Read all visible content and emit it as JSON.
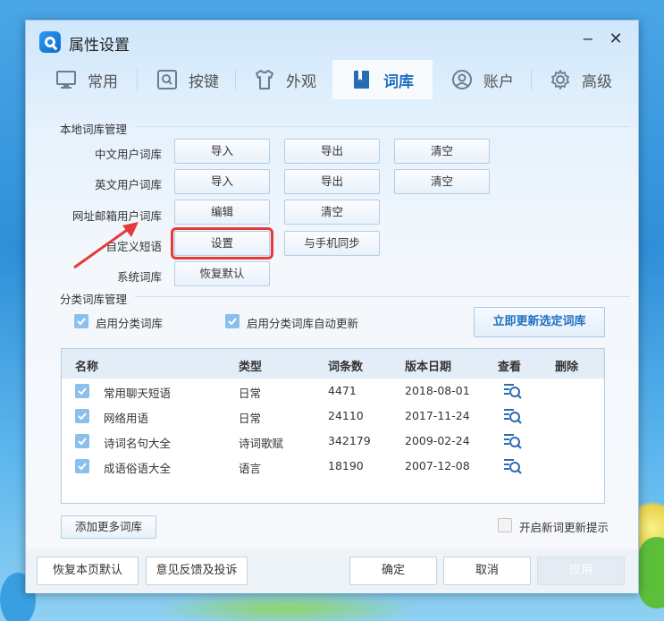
{
  "window": {
    "title": "属性设置",
    "minimize_glyph": "−",
    "close_glyph": "✕"
  },
  "tabs": [
    {
      "label": "常用",
      "icon": "monitor-icon"
    },
    {
      "label": "按键",
      "icon": "key-icon"
    },
    {
      "label": "外观",
      "icon": "shirt-icon"
    },
    {
      "label": "词库",
      "icon": "book-icon",
      "active": true
    },
    {
      "label": "账户",
      "icon": "user-icon"
    },
    {
      "label": "高级",
      "icon": "gear-icon"
    }
  ],
  "local": {
    "section_title": "本地词库管理",
    "rows": [
      {
        "label": "中文用户词库",
        "buttons": [
          "导入",
          "导出",
          "清空"
        ]
      },
      {
        "label": "英文用户词库",
        "buttons": [
          "导入",
          "导出",
          "清空"
        ]
      },
      {
        "label": "网址邮箱用户词库",
        "buttons": [
          "编辑",
          "清空"
        ]
      },
      {
        "label": "自定义短语",
        "buttons": [
          "设置",
          "与手机同步"
        ]
      },
      {
        "label": "系统词库",
        "buttons": [
          "恢复默认"
        ]
      }
    ]
  },
  "category": {
    "section_title": "分类词库管理",
    "enable_label": "启用分类词库",
    "auto_update_label": "启用分类词库自动更新",
    "update_button": "立即更新选定词库",
    "columns": [
      "名称",
      "类型",
      "词条数",
      "版本日期",
      "查看",
      "删除"
    ],
    "rows": [
      {
        "name": "常用聊天短语",
        "type": "日常",
        "count": "4471",
        "date": "2018-08-01"
      },
      {
        "name": "网络用语",
        "type": "日常",
        "count": "24110",
        "date": "2017-11-24"
      },
      {
        "name": "诗词名句大全",
        "type": "诗词歌赋",
        "count": "342179",
        "date": "2009-02-24"
      },
      {
        "name": "成语俗语大全",
        "type": "语言",
        "count": "18190",
        "date": "2007-12-08"
      }
    ],
    "add_more": "添加更多词库",
    "notify_label": "开启新词更新提示"
  },
  "footer": {
    "restore": "恢复本页默认",
    "feedback": "意见反馈及投诉",
    "ok": "确定",
    "cancel": "取消",
    "apply": "应用"
  },
  "colors": {
    "accent": "#1f6fc1",
    "highlight": "#e53a3a",
    "check": "#8cc0ec"
  }
}
